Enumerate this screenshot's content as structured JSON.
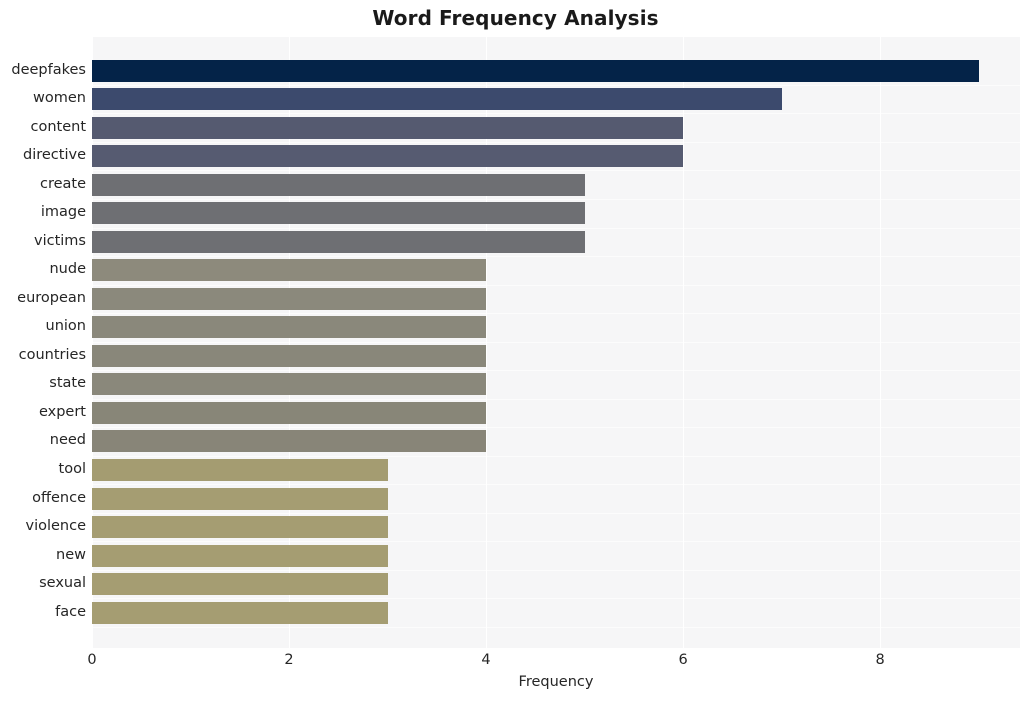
{
  "chart_data": {
    "type": "bar",
    "orientation": "horizontal",
    "title": "Word Frequency Analysis",
    "xlabel": "Frequency",
    "ylabel": "",
    "xlim": [
      0,
      9.42
    ],
    "xticks": [
      0,
      2,
      4,
      6,
      8
    ],
    "xtick_labels": [
      "0",
      "2",
      "4",
      "6",
      "8"
    ],
    "grid": true,
    "legend": null,
    "categories": [
      "deepfakes",
      "women",
      "content",
      "directive",
      "create",
      "image",
      "victims",
      "nude",
      "european",
      "union",
      "countries",
      "state",
      "expert",
      "need",
      "tool",
      "offence",
      "violence",
      "new",
      "sexual",
      "face"
    ],
    "values": [
      9,
      7,
      6,
      6,
      5,
      5,
      5,
      4,
      4,
      4,
      4,
      4,
      4,
      4,
      3,
      3,
      3,
      3,
      3,
      3
    ],
    "bar_colors": [
      "#042348",
      "#3c4a6d",
      "#555a70",
      "#565b71",
      "#6e6f73",
      "#6e6f73",
      "#6e6f73",
      "#8d8a7c",
      "#8b897c",
      "#8a887b",
      "#89877a",
      "#8a887b",
      "#888678",
      "#888578",
      "#a49c71",
      "#a59d72",
      "#a59d72",
      "#a59d72",
      "#a59d72",
      "#a59d72"
    ],
    "plot_background": "#f6f6f7",
    "gridline_color": "#ffffff",
    "figure_background": "#ffffff"
  }
}
